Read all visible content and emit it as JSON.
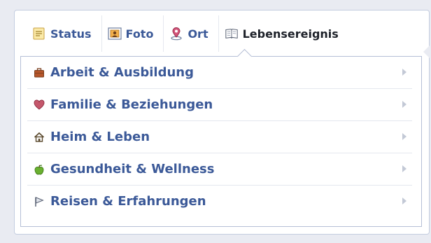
{
  "composer": {
    "tabs": [
      {
        "label": "Status",
        "icon": "status-icon"
      },
      {
        "label": "Foto",
        "icon": "photo-icon"
      },
      {
        "label": "Ort",
        "icon": "location-pin-icon"
      },
      {
        "label": "Lebensereignis",
        "icon": "book-icon",
        "active": true
      }
    ],
    "menu": [
      {
        "label": "Arbeit & Ausbildung",
        "icon": "briefcase-icon",
        "color": "#a0522d"
      },
      {
        "label": "Familie & Beziehungen",
        "icon": "heart-icon",
        "color": "#b84a5a"
      },
      {
        "label": "Heim & Leben",
        "icon": "house-icon",
        "color": "#6b5a3a"
      },
      {
        "label": "Gesundheit & Wellness",
        "icon": "apple-icon",
        "color": "#5aa02c"
      },
      {
        "label": "Reisen & Erfahrungen",
        "icon": "flag-icon",
        "color": "#7a8599"
      }
    ]
  },
  "colors": {
    "link": "#3b5998",
    "border": "#b5bfd6",
    "background": "#e9ebf2",
    "chevron": "#c3c9d6"
  }
}
